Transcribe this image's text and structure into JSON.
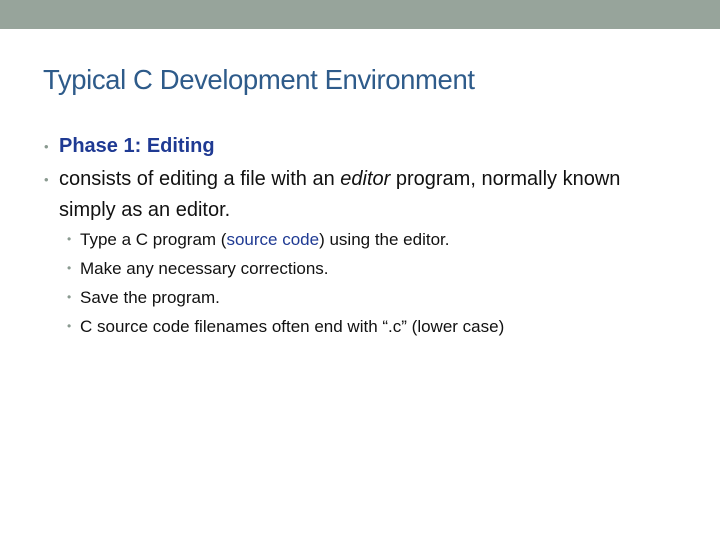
{
  "slide": {
    "title": "Typical C Development Environment",
    "bullets": {
      "b1": "Phase 1:  Editing",
      "b2_pre": "consists of editing a file with an ",
      "b2_em": "editor",
      "b2_post": " program, normally known simply as an editor.",
      "sub1_pre": "Type a C program (",
      "sub1_blue": "source code",
      "sub1_post": ") using the editor.",
      "sub2": "Make any necessary corrections.",
      "sub3": "Save the program.",
      "sub4": "C source code filenames often end with “.c” (lower case)"
    }
  },
  "colors": {
    "top_bar": "#97a49b",
    "title": "#2e5b8a",
    "accent_blue": "#1f3a93",
    "bullet": "#8a9a90"
  },
  "icons": {
    "bullet": "bullet-dot-icon"
  }
}
